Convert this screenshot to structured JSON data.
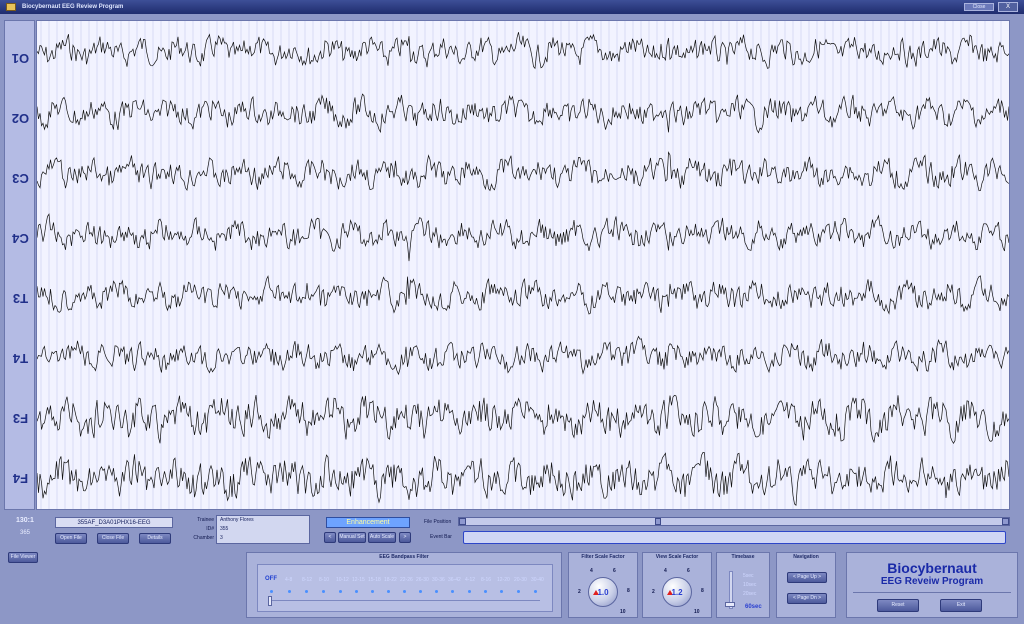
{
  "window": {
    "title": "Biocybernaut EEG Review Program",
    "close_label": "Close",
    "x_label": "X"
  },
  "channels": [
    "O1",
    "O2",
    "C3",
    "C4",
    "T3",
    "T4",
    "F3",
    "F4"
  ],
  "status": {
    "ratio": "130:1",
    "count": "365"
  },
  "file": {
    "id": "355AF_D3A01PHX16-EEG"
  },
  "buttons": {
    "open_file": "Open File",
    "close_file": "Close File",
    "details": "Details",
    "file_viewer": "File Viewer"
  },
  "info": {
    "trainee_label": "Trainee",
    "trainee": "Anthony Flores",
    "id_label": "ID#",
    "id": "355",
    "chamber_label": "Chamber",
    "chamber": "3"
  },
  "enhancement": {
    "label": "Enhancement",
    "prev": "<",
    "next": ">",
    "manual_set": "Manual Set",
    "auto_scale": "Auto Scale"
  },
  "file_position_label": "File Position",
  "event_bar_label": "Event Bar",
  "bandpass": {
    "title": "EEG Bandpass Filter",
    "options": [
      "OFF",
      "4-8",
      "8-12",
      "8-10",
      "10-12",
      "12-15",
      "15-18",
      "18-22",
      "22-26",
      "26-30",
      "30-36",
      "36-42",
      "4-12",
      "8-16",
      "12-20",
      "20-30",
      "30-40"
    ]
  },
  "filter_scale": {
    "title": "Filter Scale Factor",
    "value": "1.0",
    "ticks": [
      "2",
      "4",
      "6",
      "8",
      "10"
    ]
  },
  "view_scale": {
    "title": "View Scale Factor",
    "value": "1.2",
    "ticks": [
      "2",
      "4",
      "6",
      "8",
      "10"
    ]
  },
  "timebase": {
    "title": "Timebase",
    "options": [
      "5sec",
      "10sec",
      "20sec"
    ],
    "value": "60sec"
  },
  "navigation": {
    "title": "Navigation",
    "page_up": "< Page Up >",
    "page_down": "< Page Dn >"
  },
  "brand": {
    "line1": "Biocybernaut",
    "line2": "EEG Reveiw Program",
    "reset": "Reset",
    "exit": "Exit"
  }
}
